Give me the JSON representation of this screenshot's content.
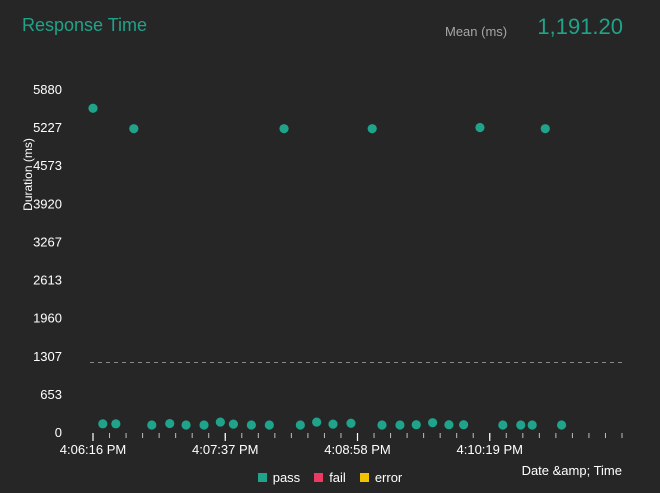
{
  "header": {
    "title": "Response Time",
    "mean_label": "Mean (ms)",
    "mean_value": "1,191.20"
  },
  "colors": {
    "pass": "#1fa38a",
    "fail": "#ec3a64",
    "error": "#f2c200",
    "background": "#262626",
    "text": "#ffffff"
  },
  "chart_data": {
    "type": "scatter",
    "xlabel": "Date &amp; Time",
    "ylabel": "Duration (ms)",
    "ylim": [
      0,
      5880
    ],
    "yticks": [
      0,
      653,
      1307,
      1960,
      2613,
      3267,
      3920,
      4573,
      5227,
      5880
    ],
    "xlim": [
      "4:06:16 PM",
      "4:11:40 PM"
    ],
    "xticks": [
      "4:06:16 PM",
      "4:07:37 PM",
      "4:08:58 PM",
      "4:10:19 PM"
    ],
    "mean_line": 1191.2,
    "legend": [
      "pass",
      "fail",
      "error"
    ],
    "series": [
      {
        "name": "pass",
        "points": [
          {
            "x": "4:06:16 PM",
            "y": 5550
          },
          {
            "x": "4:06:22 PM",
            "y": 140
          },
          {
            "x": "4:06:30 PM",
            "y": 140
          },
          {
            "x": "4:06:41 PM",
            "y": 5200
          },
          {
            "x": "4:06:52 PM",
            "y": 120
          },
          {
            "x": "4:07:03 PM",
            "y": 145
          },
          {
            "x": "4:07:13 PM",
            "y": 120
          },
          {
            "x": "4:07:24 PM",
            "y": 120
          },
          {
            "x": "4:07:34 PM",
            "y": 170
          },
          {
            "x": "4:07:42 PM",
            "y": 135
          },
          {
            "x": "4:07:53 PM",
            "y": 120
          },
          {
            "x": "4:08:04 PM",
            "y": 120
          },
          {
            "x": "4:08:13 PM",
            "y": 5200
          },
          {
            "x": "4:08:23 PM",
            "y": 120
          },
          {
            "x": "4:08:33 PM",
            "y": 170
          },
          {
            "x": "4:08:43 PM",
            "y": 135
          },
          {
            "x": "4:08:54 PM",
            "y": 150
          },
          {
            "x": "4:09:07 PM",
            "y": 5200
          },
          {
            "x": "4:09:13 PM",
            "y": 120
          },
          {
            "x": "4:09:24 PM",
            "y": 120
          },
          {
            "x": "4:09:34 PM",
            "y": 125
          },
          {
            "x": "4:09:44 PM",
            "y": 160
          },
          {
            "x": "4:09:54 PM",
            "y": 125
          },
          {
            "x": "4:10:03 PM",
            "y": 125
          },
          {
            "x": "4:10:13 PM",
            "y": 5220
          },
          {
            "x": "4:10:27 PM",
            "y": 120
          },
          {
            "x": "4:10:38 PM",
            "y": 120
          },
          {
            "x": "4:10:45 PM",
            "y": 120
          },
          {
            "x": "4:10:53 PM",
            "y": 5200
          },
          {
            "x": "4:11:03 PM",
            "y": 120
          }
        ]
      },
      {
        "name": "fail",
        "points": []
      },
      {
        "name": "error",
        "points": []
      }
    ]
  }
}
